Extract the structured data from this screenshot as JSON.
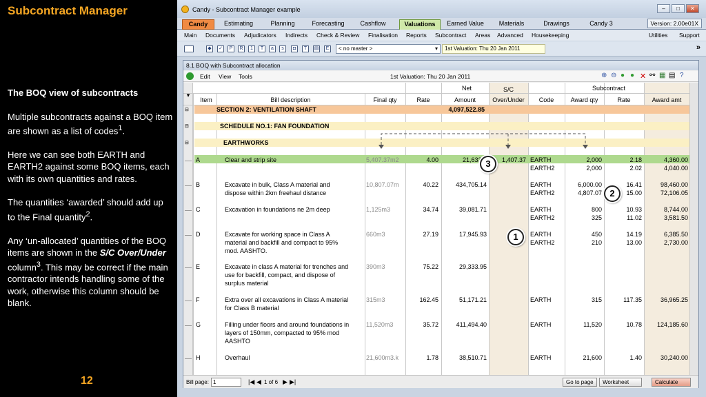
{
  "slide": {
    "title": "Subcontract Manager",
    "heading": "The BOQ view of subcontracts",
    "p1a": "Multiple subcontracts against a BOQ item are shown as a list of codes",
    "p1sup": "1",
    "p1b": ".",
    "p2": "Here we can see both EARTH and EARTH2 against some BOQ items, each with its own quantities and rates.",
    "p3a": "The quantities ‘awarded’ should add up to the Final quantity",
    "p3sup": "2",
    "p3b": ".",
    "p4a": "Any ‘un-allocated’ quantities of the BOQ items are shown in the ",
    "p4em": "S/C Over/Under",
    "p4b": " column",
    "p4sup": "3",
    "p4c": ".  This may be correct if the main contractor intends handling some of the work, otherwise this column should be blank.",
    "page_number": "12"
  },
  "app": {
    "title": "Candy - Subcontract Manager example",
    "version": "Version: 2.00e01X",
    "tabs": [
      "Candy",
      "Estimating",
      "Planning",
      "Forecasting",
      "Cashflow",
      "Valuations",
      "Earned Value",
      "Materials",
      "Drawings",
      "Candy 3"
    ],
    "menu": [
      "Main",
      "Documents",
      "Adjudicators",
      "Indirects",
      "Check & Review",
      "Finalisation",
      "Reports",
      "Subcontract",
      "Areas",
      "Advanced",
      "Housekeeping"
    ],
    "menu_right": [
      "Utilities",
      "Support"
    ],
    "master": "< no master >",
    "valuation": "1st Valuation: Thu 20 Jan 2011"
  },
  "window": {
    "title": "8.1 BOQ with Subcontract allocation",
    "menu": [
      "Edit",
      "View",
      "Tools"
    ],
    "valuation": "1st Valuation: Thu 20 Jan 2011"
  },
  "headers": {
    "net": "Net",
    "sc": "S/C",
    "subcontract": "Subcontract",
    "item": "Item",
    "desc": "Bill description",
    "final_qty": "Final qty",
    "rate": "Rate",
    "amount": "Amount",
    "over_under": "Over/Under",
    "code": "Code",
    "award_qty": "Award qty",
    "sub_rate": "Rate",
    "award_amt": "Award amt"
  },
  "sections": [
    {
      "label": "SECTION 2: VENTILATION SHAFT",
      "amount": "4,097,522.85"
    },
    {
      "label": "SCHEDULE NO.1: FAN FOUNDATION"
    },
    {
      "label": "EARTHWORKS"
    }
  ],
  "rows": [
    {
      "item": "A",
      "desc": [
        "Clear and strip site"
      ],
      "qty": "5,407.37m2",
      "rate": "4.00",
      "amount": "21,633.8",
      "over": "1,407.37",
      "codes": [
        "EARTH",
        "EARTH2"
      ],
      "aq": [
        "2,000",
        "2,000"
      ],
      "sr": [
        "2.18",
        "2.02"
      ],
      "aa": [
        "4,360.00",
        "4,040.00"
      ]
    },
    {
      "item": "B",
      "desc": [
        "Excavate in bulk, Class A material and",
        "dispose within 2km freehaul distance"
      ],
      "qty": "10,807.07m",
      "rate": "40.22",
      "amount": "434,705.14",
      "over": "",
      "codes": [
        "EARTH",
        "EARTH2"
      ],
      "aq": [
        "6,000.00",
        "4,807.07"
      ],
      "sr": [
        "16.41",
        "15.00"
      ],
      "aa": [
        "98,460.00",
        "72,106.05"
      ]
    },
    {
      "item": "C",
      "desc": [
        "Excavation in foundations ne 2m deep"
      ],
      "qty": "1,125m3",
      "rate": "34.74",
      "amount": "39,081.71",
      "over": "",
      "codes": [
        "EARTH",
        "EARTH2"
      ],
      "aq": [
        "800",
        "325"
      ],
      "sr": [
        "10.93",
        "11.02"
      ],
      "aa": [
        "8,744.00",
        "3,581.50"
      ]
    },
    {
      "item": "D",
      "desc": [
        "Excavate for working space in Class A",
        "material and backfill and compact to 95%",
        "mod. AASHTO."
      ],
      "qty": "660m3",
      "rate": "27.19",
      "amount": "17,945.93",
      "over": "",
      "codes": [
        "EARTH",
        "EARTH2"
      ],
      "aq": [
        "450",
        "210"
      ],
      "sr": [
        "14.19",
        "13.00"
      ],
      "aa": [
        "6,385.50",
        "2,730.00"
      ]
    },
    {
      "item": "E",
      "desc": [
        "Excavate in class A material for trenches and",
        "use for backfill, compact, and dispose of",
        "surplus material"
      ],
      "qty": "390m3",
      "rate": "75.22",
      "amount": "29,333.95",
      "over": "",
      "codes": [],
      "aq": [],
      "sr": [],
      "aa": []
    },
    {
      "item": "F",
      "desc": [
        "Extra over all excavations in Class A material",
        "for Class B material"
      ],
      "qty": "315m3",
      "rate": "162.45",
      "amount": "51,171.21",
      "over": "",
      "codes": [
        "EARTH"
      ],
      "aq": [
        "315"
      ],
      "sr": [
        "117.35"
      ],
      "aa": [
        "36,965.25"
      ]
    },
    {
      "item": "G",
      "desc": [
        "Filling under floors and around foundations in",
        "layers of 150mm, compacted to 95% mod",
        "AASHTO"
      ],
      "qty": "11,520m3",
      "rate": "35.72",
      "amount": "411,494.40",
      "over": "",
      "codes": [
        "EARTH"
      ],
      "aq": [
        "11,520"
      ],
      "sr": [
        "10.78"
      ],
      "aa": [
        "124,185.60"
      ]
    },
    {
      "item": "H",
      "desc": [
        "Overhaul"
      ],
      "qty": "21,600m3.k",
      "rate": "1.78",
      "amount": "38,510.71",
      "over": "",
      "codes": [
        "EARTH"
      ],
      "aq": [
        "21,600"
      ],
      "sr": [
        "1.40"
      ],
      "aa": [
        "30,240.00"
      ]
    }
  ],
  "status": {
    "bill_page_label": "Bill page:",
    "bill_page": "1",
    "page_of": "1 of 6",
    "goto": "Go to page",
    "worksheet": "Worksheet",
    "calculate": "Calculate"
  },
  "callouts": [
    "1",
    "2",
    "3"
  ]
}
